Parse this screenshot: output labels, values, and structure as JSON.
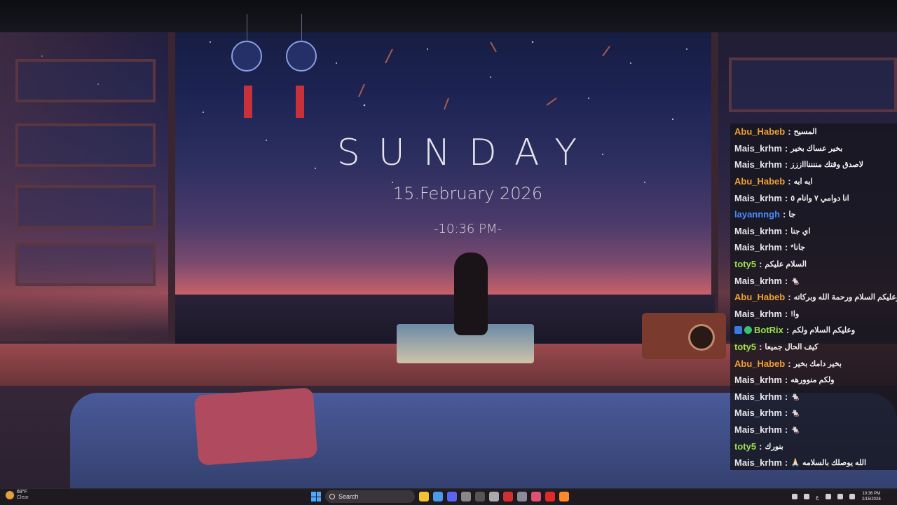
{
  "clock_widget": {
    "day": "SUNDAY",
    "date": "15.February 2026",
    "time": "-10:36 PM-"
  },
  "chat": {
    "messages": [
      {
        "user": "Abu_Habeb",
        "color": "#f0a030",
        "text": "المسيح"
      },
      {
        "user": "Mais_krhm",
        "color": "#e8e8ee",
        "text": "بخير عساك بخير"
      },
      {
        "user": "Mais_krhm",
        "color": "#e8e8ee",
        "text": "لاصدق وقتك منننناااززز"
      },
      {
        "user": "Abu_Habeb",
        "color": "#f0a030",
        "text": "ايه ايه"
      },
      {
        "user": "Mais_krhm",
        "color": "#e8e8ee",
        "text": "انا دوامي ٧ وانام ٥"
      },
      {
        "user": "layannngh",
        "color": "#4a8cff",
        "text": "جا"
      },
      {
        "user": "Mais_krhm",
        "color": "#e8e8ee",
        "text": "اي جنا"
      },
      {
        "user": "Mais_krhm",
        "color": "#e8e8ee",
        "text": "جانا*"
      },
      {
        "user": "toty5",
        "color": "#9ae04a",
        "text": "السلام عليكم"
      },
      {
        "user": "Mais_krhm",
        "color": "#e8e8ee",
        "text": "🐁"
      },
      {
        "user": "Abu_Habeb",
        "color": "#f0a030",
        "text": "وعليكم السلام ورحمة الله وبركاته"
      },
      {
        "user": "Mais_krhm",
        "color": "#e8e8ee",
        "text": "وا!"
      },
      {
        "user": "BotRix",
        "color": "#9ae04a",
        "text": "وعليكم السلام ولكم",
        "bot": true
      },
      {
        "user": "toty5",
        "color": "#9ae04a",
        "text": "كيف الحال جميعا"
      },
      {
        "user": "Abu_Habeb",
        "color": "#f0a030",
        "text": "بخير دامك بخير"
      },
      {
        "user": "Mais_krhm",
        "color": "#e8e8ee",
        "text": "ولكم منوورهه"
      },
      {
        "user": "Mais_krhm",
        "color": "#e8e8ee",
        "text": "🐁"
      },
      {
        "user": "Mais_krhm",
        "color": "#e8e8ee",
        "text": "🐁"
      },
      {
        "user": "Mais_krhm",
        "color": "#e8e8ee",
        "text": "🐁"
      },
      {
        "user": "toty5",
        "color": "#9ae04a",
        "text": "بنورك"
      },
      {
        "user": "Mais_krhm",
        "color": "#e8e8ee",
        "text": "الله يوصلك بالسلامه 🙏🏻"
      }
    ]
  },
  "taskbar": {
    "weather_temp": "69°F",
    "weather_condition": "Clear",
    "search_label": "Search",
    "apps": [
      {
        "name": "file-explorer-icon",
        "color": "#f2c230"
      },
      {
        "name": "chrome-icon",
        "color": "#4a9ae8"
      },
      {
        "name": "discord-icon",
        "color": "#5865f2"
      },
      {
        "name": "media-icon",
        "color": "#888888"
      },
      {
        "name": "obs-icon",
        "color": "#555555"
      },
      {
        "name": "app-icon",
        "color": "#aaaaaa"
      },
      {
        "name": "app-red-icon",
        "color": "#d03030"
      },
      {
        "name": "steam-icon",
        "color": "#8a8a9a"
      },
      {
        "name": "app-pink-icon",
        "color": "#e05070"
      },
      {
        "name": "adobe-icon",
        "color": "#e02a2a"
      },
      {
        "name": "firefox-icon",
        "color": "#ff8a2a"
      }
    ],
    "tray_lang": "ع",
    "clock_time": "10:36 PM",
    "clock_date": "2/15/2026"
  }
}
